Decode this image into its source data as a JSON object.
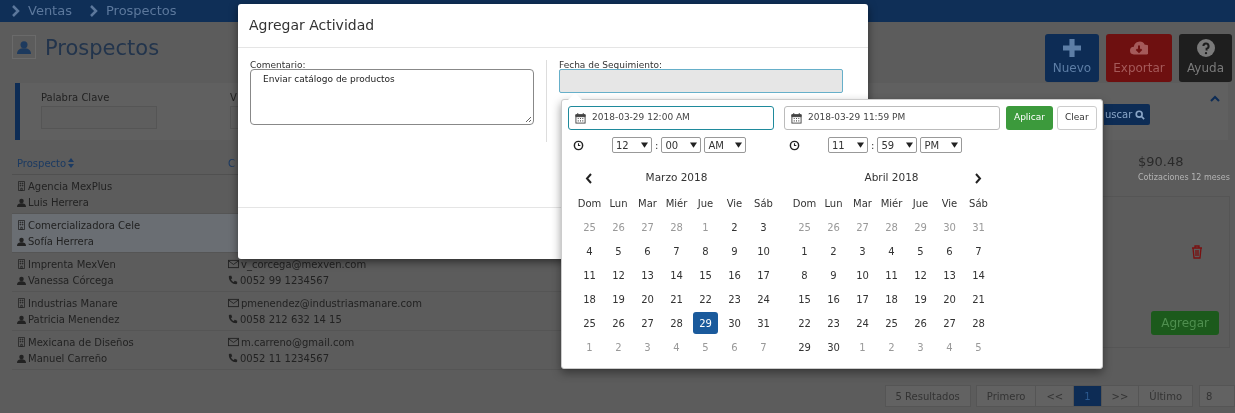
{
  "breadcrumb": [
    {
      "label": "Ventas"
    },
    {
      "label": "Prospectos"
    }
  ],
  "page_title": "Prospectos",
  "actions": [
    {
      "label": "Nuevo",
      "kind": "new"
    },
    {
      "label": "Exportar",
      "kind": "export"
    },
    {
      "label": "Ayuda",
      "kind": "help"
    }
  ],
  "filters": {
    "fields": [
      {
        "label": "Palabra Clave"
      },
      {
        "label": "V"
      }
    ],
    "search_button": "uscar"
  },
  "table": {
    "columns": [
      "Prospecto",
      "C"
    ],
    "rows": [
      {
        "company": "Agencia MexPlus",
        "contact": "Luis Herrera",
        "selected": false
      },
      {
        "company": "Comercializadora Cele",
        "contact": "Sofía Herrera",
        "selected": true
      },
      {
        "company": "Imprenta MexVen",
        "contact": "Vanessa Córcega",
        "email": "v_corcega@mexven.com",
        "phone": "0052 99 1234567",
        "selected": false
      },
      {
        "company": "Industrias Manare",
        "contact": "Patricia Menendez",
        "email": "pmenendez@industriasmanare.com",
        "phone": "0058 212 632 14 15",
        "selected": false
      },
      {
        "company": "Mexicana de Diseños",
        "contact": "Manuel Carreño",
        "email": "m.carreno@gmail.com",
        "phone": "0052 11 1234567",
        "selected": false
      }
    ]
  },
  "summary": {
    "amount": "$90.48",
    "caption": "Cotizaciones 12 meses"
  },
  "side_panel": {
    "add_button": "Agregar"
  },
  "pagination": {
    "results": "5 Resultados",
    "pages": [
      {
        "label": "Primero",
        "selected": false
      },
      {
        "label": "<<",
        "selected": false
      },
      {
        "label": "1",
        "selected": true
      },
      {
        "label": ">>",
        "selected": false
      },
      {
        "label": "Último",
        "selected": false
      }
    ],
    "page_size": "8"
  },
  "modal": {
    "title": "Agregar Actividad",
    "comment": {
      "label": "Comentario:",
      "value": "Enviar catálogo de productos"
    },
    "follow_up": {
      "label": "Fecha de Seguimiento:"
    }
  },
  "date_picker": {
    "ranges": [
      {
        "value": "2018-03-29 12:00 AM",
        "active": true,
        "hour": "12",
        "separator": ":",
        "minute": "00",
        "ampm": "AM"
      },
      {
        "value": "2018-03-29 11:59 PM",
        "active": false,
        "hour": "11",
        "separator": ":",
        "minute": "59",
        "ampm": "PM"
      }
    ],
    "apply": "Aplicar",
    "clear": "Clear",
    "calendars": [
      {
        "month": "Marzo 2018",
        "kind": "prev",
        "weekdays": [
          "Dom",
          "Lun",
          "Mar",
          "Miér",
          "Jue",
          "Vie",
          "Sáb"
        ],
        "weeks": [
          [
            {
              "day": "25",
              "off": true,
              "selected": false
            },
            {
              "day": "26",
              "off": true,
              "selected": false
            },
            {
              "day": "27",
              "off": true,
              "selected": false
            },
            {
              "day": "28",
              "off": true,
              "selected": false
            },
            {
              "day": "1",
              "off": true,
              "selected": false
            },
            {
              "day": "2",
              "off": false,
              "selected": false
            },
            {
              "day": "3",
              "off": false,
              "selected": false
            }
          ],
          [
            {
              "day": "4",
              "off": false,
              "selected": false
            },
            {
              "day": "5",
              "off": false,
              "selected": false
            },
            {
              "day": "6",
              "off": false,
              "selected": false
            },
            {
              "day": "7",
              "off": false,
              "selected": false
            },
            {
              "day": "8",
              "off": false,
              "selected": false
            },
            {
              "day": "9",
              "off": false,
              "selected": false
            },
            {
              "day": "10",
              "off": false,
              "selected": false
            }
          ],
          [
            {
              "day": "11",
              "off": false,
              "selected": false
            },
            {
              "day": "12",
              "off": false,
              "selected": false
            },
            {
              "day": "13",
              "off": false,
              "selected": false
            },
            {
              "day": "14",
              "off": false,
              "selected": false
            },
            {
              "day": "15",
              "off": false,
              "selected": false
            },
            {
              "day": "16",
              "off": false,
              "selected": false
            },
            {
              "day": "17",
              "off": false,
              "selected": false
            }
          ],
          [
            {
              "day": "18",
              "off": false,
              "selected": false
            },
            {
              "day": "19",
              "off": false,
              "selected": false
            },
            {
              "day": "20",
              "off": false,
              "selected": false
            },
            {
              "day": "21",
              "off": false,
              "selected": false
            },
            {
              "day": "22",
              "off": false,
              "selected": false
            },
            {
              "day": "23",
              "off": false,
              "selected": false
            },
            {
              "day": "24",
              "off": false,
              "selected": false
            }
          ],
          [
            {
              "day": "25",
              "off": false,
              "selected": false
            },
            {
              "day": "26",
              "off": false,
              "selected": false
            },
            {
              "day": "27",
              "off": false,
              "selected": false
            },
            {
              "day": "28",
              "off": false,
              "selected": false
            },
            {
              "day": "29",
              "off": false,
              "selected": true
            },
            {
              "day": "30",
              "off": false,
              "selected": false
            },
            {
              "day": "31",
              "off": false,
              "selected": false
            }
          ],
          [
            {
              "day": "1",
              "off": true,
              "selected": false
            },
            {
              "day": "2",
              "off": true,
              "selected": false
            },
            {
              "day": "3",
              "off": true,
              "selected": false
            },
            {
              "day": "4",
              "off": true,
              "selected": false
            },
            {
              "day": "5",
              "off": true,
              "selected": false
            },
            {
              "day": "6",
              "off": true,
              "selected": false
            },
            {
              "day": "7",
              "off": true,
              "selected": false
            }
          ]
        ]
      },
      {
        "month": "Abril 2018",
        "kind": "next",
        "weekdays": [
          "Dom",
          "Lun",
          "Mar",
          "Miér",
          "Jue",
          "Vie",
          "Sáb"
        ],
        "weeks": [
          [
            {
              "day": "25",
              "off": true,
              "selected": false
            },
            {
              "day": "26",
              "off": true,
              "selected": false
            },
            {
              "day": "27",
              "off": true,
              "selected": false
            },
            {
              "day": "28",
              "off": true,
              "selected": false
            },
            {
              "day": "29",
              "off": true,
              "selected": false
            },
            {
              "day": "30",
              "off": true,
              "selected": false
            },
            {
              "day": "31",
              "off": true,
              "selected": false
            }
          ],
          [
            {
              "day": "1",
              "off": false,
              "selected": false
            },
            {
              "day": "2",
              "off": false,
              "selected": false
            },
            {
              "day": "3",
              "off": false,
              "selected": false
            },
            {
              "day": "4",
              "off": false,
              "selected": false
            },
            {
              "day": "5",
              "off": false,
              "selected": false
            },
            {
              "day": "6",
              "off": false,
              "selected": false
            },
            {
              "day": "7",
              "off": false,
              "selected": false
            }
          ],
          [
            {
              "day": "8",
              "off": false,
              "selected": false
            },
            {
              "day": "9",
              "off": false,
              "selected": false
            },
            {
              "day": "10",
              "off": false,
              "selected": false
            },
            {
              "day": "11",
              "off": false,
              "selected": false
            },
            {
              "day": "12",
              "off": false,
              "selected": false
            },
            {
              "day": "13",
              "off": false,
              "selected": false
            },
            {
              "day": "14",
              "off": false,
              "selected": false
            }
          ],
          [
            {
              "day": "15",
              "off": false,
              "selected": false
            },
            {
              "day": "16",
              "off": false,
              "selected": false
            },
            {
              "day": "17",
              "off": false,
              "selected": false
            },
            {
              "day": "18",
              "off": false,
              "selected": false
            },
            {
              "day": "19",
              "off": false,
              "selected": false
            },
            {
              "day": "20",
              "off": false,
              "selected": false
            },
            {
              "day": "21",
              "off": false,
              "selected": false
            }
          ],
          [
            {
              "day": "22",
              "off": false,
              "selected": false
            },
            {
              "day": "23",
              "off": false,
              "selected": false
            },
            {
              "day": "24",
              "off": false,
              "selected": false
            },
            {
              "day": "25",
              "off": false,
              "selected": false
            },
            {
              "day": "26",
              "off": false,
              "selected": false
            },
            {
              "day": "27",
              "off": false,
              "selected": false
            },
            {
              "day": "28",
              "off": false,
              "selected": false
            }
          ],
          [
            {
              "day": "29",
              "off": false,
              "selected": false
            },
            {
              "day": "30",
              "off": false,
              "selected": false
            },
            {
              "day": "1",
              "off": true,
              "selected": false
            },
            {
              "day": "2",
              "off": true,
              "selected": false
            },
            {
              "day": "3",
              "off": true,
              "selected": false
            },
            {
              "day": "4",
              "off": true,
              "selected": false
            },
            {
              "day": "5",
              "off": true,
              "selected": false
            }
          ]
        ]
      }
    ]
  }
}
